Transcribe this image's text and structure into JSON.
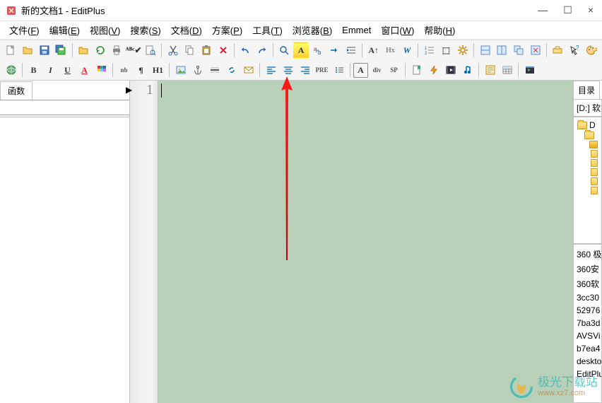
{
  "window": {
    "title": "新的文档1 - EditPlus",
    "minimize": "—",
    "maximize": "☐",
    "close": "×"
  },
  "menu": [
    {
      "label": "文件",
      "key": "F"
    },
    {
      "label": "编辑",
      "key": "E"
    },
    {
      "label": "视图",
      "key": "V"
    },
    {
      "label": "搜索",
      "key": "S"
    },
    {
      "label": "文档",
      "key": "D"
    },
    {
      "label": "方案",
      "key": "P"
    },
    {
      "label": "工具",
      "key": "T"
    },
    {
      "label": "浏览器",
      "key": "B"
    },
    {
      "label": "Emmet",
      "key": ""
    },
    {
      "label": "窗口",
      "key": "W"
    },
    {
      "label": "帮助",
      "key": "H"
    }
  ],
  "toolbar_row1": [
    {
      "name": "new-file-icon",
      "type": "svg_newfile"
    },
    {
      "name": "open-file-icon",
      "type": "svg_open"
    },
    {
      "name": "save-icon",
      "type": "svg_save"
    },
    {
      "name": "save-all-icon",
      "type": "svg_saveall"
    },
    {
      "name": "sep"
    },
    {
      "name": "open-remote-icon",
      "type": "svg_open2"
    },
    {
      "name": "remote-save-icon",
      "type": "svg_refresh"
    },
    {
      "name": "print-icon",
      "type": "svg_print"
    },
    {
      "name": "spellcheck-icon",
      "type": "txt",
      "txt": "ᴬᴮᶜ✔"
    },
    {
      "name": "preview-icon",
      "type": "svg_preview"
    },
    {
      "name": "sep"
    },
    {
      "name": "cut-icon",
      "type": "svg_cut"
    },
    {
      "name": "copy-icon",
      "type": "svg_copy"
    },
    {
      "name": "paste-icon",
      "type": "svg_paste"
    },
    {
      "name": "delete-icon",
      "type": "svg_delete"
    },
    {
      "name": "sep"
    },
    {
      "name": "undo-icon",
      "type": "svg_undo"
    },
    {
      "name": "redo-icon",
      "type": "svg_redo"
    },
    {
      "name": "sep"
    },
    {
      "name": "find-icon",
      "type": "svg_find"
    },
    {
      "name": "highlight-icon",
      "type": "txt",
      "txt": "A"
    },
    {
      "name": "replace-icon",
      "type": "svg_replace"
    },
    {
      "name": "goto-icon",
      "type": "svg_goto"
    },
    {
      "name": "indent-icon",
      "type": "svg_indent"
    },
    {
      "name": "sep"
    },
    {
      "name": "font-larger-icon",
      "type": "txt",
      "txt": "A↑"
    },
    {
      "name": "hex-icon",
      "type": "txt",
      "txt": "Hx"
    },
    {
      "name": "wordwrap-icon",
      "type": "txt",
      "txt": "W"
    },
    {
      "name": "sep"
    },
    {
      "name": "line-num-icon",
      "type": "svg_linenum"
    },
    {
      "name": "ruler-icon",
      "type": "txt",
      "txt": "⬚"
    },
    {
      "name": "settings-icon",
      "type": "svg_gear"
    },
    {
      "name": "sep"
    },
    {
      "name": "window-tile1-icon",
      "type": "svg_winh"
    },
    {
      "name": "window-tile2-icon",
      "type": "svg_winv"
    },
    {
      "name": "window-cascade-icon",
      "type": "svg_wincasc"
    },
    {
      "name": "window-close-icon",
      "type": "svg_winclose"
    },
    {
      "name": "sep"
    },
    {
      "name": "tool1-icon",
      "type": "svg_tool1"
    },
    {
      "name": "help-arrow-icon",
      "type": "svg_helparrow"
    },
    {
      "name": "palette-icon",
      "type": "svg_palette"
    }
  ],
  "toolbar_row2": [
    {
      "name": "browser-icon",
      "type": "svg_globe"
    },
    {
      "name": "sep"
    },
    {
      "name": "bold-icon",
      "type": "txt",
      "txt": "B"
    },
    {
      "name": "italic-icon",
      "type": "txt",
      "txt": "I"
    },
    {
      "name": "underline-icon",
      "type": "txt",
      "txt": "U"
    },
    {
      "name": "font-color-icon",
      "type": "txt",
      "txt": "A"
    },
    {
      "name": "color-picker-icon",
      "type": "svg_colorgrid"
    },
    {
      "name": "sep"
    },
    {
      "name": "nbsp-icon",
      "type": "txt",
      "txt": "nb"
    },
    {
      "name": "paragraph-icon",
      "type": "txt",
      "txt": "¶"
    },
    {
      "name": "heading-icon",
      "type": "txt",
      "txt": "H1"
    },
    {
      "name": "sep"
    },
    {
      "name": "image-icon",
      "type": "svg_image"
    },
    {
      "name": "anchor-icon",
      "type": "svg_anchor"
    },
    {
      "name": "hr-icon",
      "type": "svg_hr"
    },
    {
      "name": "link-icon",
      "type": "svg_link"
    },
    {
      "name": "mail-icon",
      "type": "svg_mail"
    },
    {
      "name": "sep"
    },
    {
      "name": "align-left-icon",
      "type": "svg_alignl"
    },
    {
      "name": "align-center-icon",
      "type": "svg_alignc"
    },
    {
      "name": "align-right-icon",
      "type": "svg_alignr"
    },
    {
      "name": "pre-icon",
      "type": "txt",
      "txt": "PRE"
    },
    {
      "name": "list-icon",
      "type": "svg_list"
    },
    {
      "name": "sep"
    },
    {
      "name": "text-area-icon",
      "type": "txt",
      "txt": "A"
    },
    {
      "name": "div-icon",
      "type": "txt",
      "txt": "div"
    },
    {
      "name": "span-icon",
      "type": "txt",
      "txt": "SP"
    },
    {
      "name": "sep"
    },
    {
      "name": "bookmark-icon",
      "type": "svg_bookmark"
    },
    {
      "name": "flash-icon",
      "type": "svg_flash"
    },
    {
      "name": "video-icon",
      "type": "svg_video"
    },
    {
      "name": "audio-icon",
      "type": "svg_audio"
    },
    {
      "name": "sep"
    },
    {
      "name": "form-icon",
      "type": "svg_form"
    },
    {
      "name": "table-icon",
      "type": "svg_table"
    },
    {
      "name": "sep"
    },
    {
      "name": "run-icon",
      "type": "svg_run"
    }
  ],
  "left": {
    "tab_label": "函数",
    "input_value": ""
  },
  "editor": {
    "line_number": "1"
  },
  "right": {
    "tab_label": "目录",
    "drive": "[D:] 软",
    "tree": [
      {
        "indent": 0,
        "label": "D",
        "open": true
      },
      {
        "indent": 1,
        "label": "",
        "open": true
      },
      {
        "indent": 2,
        "label": "",
        "sel": true
      },
      {
        "indent": 3,
        "label": ""
      },
      {
        "indent": 3,
        "label": ""
      },
      {
        "indent": 3,
        "label": ""
      },
      {
        "indent": 3,
        "label": ""
      },
      {
        "indent": 3,
        "label": ""
      }
    ],
    "files": [
      "360 极",
      "360安",
      "360软",
      "3cc30",
      "52976",
      "7ba3d",
      "AVSVi",
      "b7ea4",
      "deskto",
      "EditPlu"
    ]
  },
  "watermark": {
    "name": "极光下载站",
    "url": "www.xz7.com"
  }
}
